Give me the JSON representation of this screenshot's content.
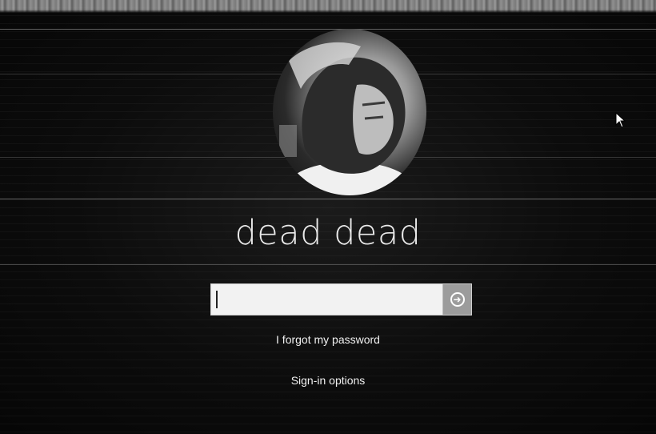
{
  "lock_screen": {
    "user_name": "dead dead",
    "password": {
      "value": "",
      "placeholder": ""
    },
    "submit_icon": "arrow-right-circle-icon",
    "forgot_password_label": "I forgot my password",
    "sign_in_options_label": "Sign-in options",
    "pointer_icon": "mouse-pointer-icon"
  },
  "colors": {
    "background": "#0b0b0b",
    "text": "#e9e9e9",
    "input_background": "#f2f2f2",
    "submit_button": "#9c9c9c"
  }
}
